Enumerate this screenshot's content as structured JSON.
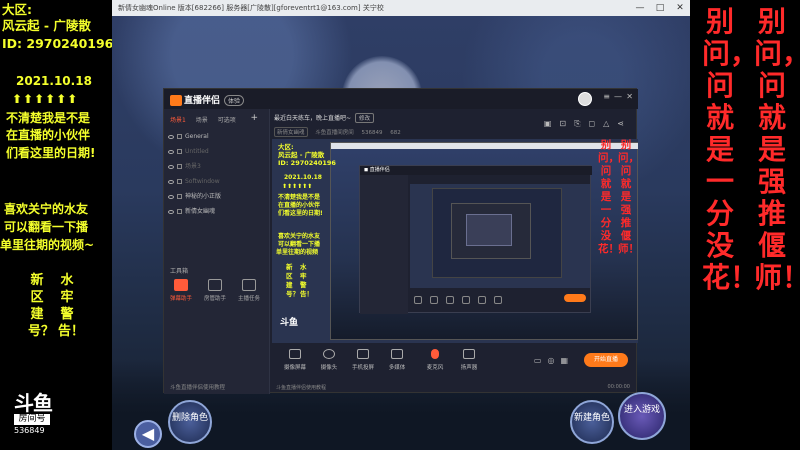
{
  "left_overlay": {
    "line1": "大区:",
    "line2": "风云起 - 广陵散",
    "line3": "ID: 2970240196",
    "date": "2021.10.18",
    "arrows": "⬆⬆⬆⬆⬆⬆",
    "note1": "不清楚我是不是",
    "note2": "在直播的小伙伴",
    "note3": "们看这里的日期!",
    "note4": "喜欢关宁的水友",
    "note5": "可以翻看一下播",
    "note6": "单里往期的视频~",
    "vert_left": "新区建号？",
    "vert_right": "水牢警告！"
  },
  "douyu": {
    "mark": "斗鱼",
    "sub": "房间号",
    "room": "536849"
  },
  "right_overlay": {
    "col1": "别问，问就是一分没花！",
    "col2": "别问，问就是强推偃师！"
  },
  "window": {
    "title": "新倩女幽魂Online 版本[682266] 服务器[广陵散][gforeventrt1@163.com] 关宁校",
    "controls": [
      "—",
      "□",
      "✕"
    ]
  },
  "app": {
    "logo": "直播伴侣",
    "badge": "体验",
    "tabs": [
      "场景1",
      "场景",
      "可选项"
    ],
    "scenes": [
      {
        "label": "General",
        "dim": false
      },
      {
        "label": "Untitled",
        "dim": true
      },
      {
        "label": "场景3",
        "dim": true
      },
      {
        "label": "Softwindow",
        "dim": true
      },
      {
        "label": "神秘的小正版",
        "dim": false
      },
      {
        "label": "新倩女幽魂",
        "dim": false
      }
    ],
    "tools_label": "工具箱",
    "tools": [
      {
        "label": "弹幕助手",
        "hot": true
      },
      {
        "label": "房管助手",
        "hot": false
      },
      {
        "label": "主播任务",
        "hot": false
      }
    ],
    "side_bottom": "斗鱼直播伴侣使用教程",
    "stream_title": "最近白天练车，晚上直播吧~",
    "edit_label": "修改",
    "sub_tags": [
      "新倩女幽魂",
      "斗鱼直播间房间",
      "536849",
      "682"
    ],
    "toolbar": [
      {
        "label": "摄像屏幕",
        "shape": "sq"
      },
      {
        "label": "摄像头",
        "shape": "round"
      },
      {
        "label": "手机投屏",
        "shape": "sq"
      },
      {
        "label": "多媒体",
        "shape": "sq"
      },
      {
        "label": "麦克风",
        "shape": "mic"
      },
      {
        "label": "扬声器",
        "shape": "sq"
      }
    ],
    "go_live": "开始直播",
    "status_left": "斗鱼直播伴侣使用教程",
    "status_right": "00:00:00"
  },
  "inner_overlay": {
    "l1": "大区:",
    "l2": "风云起 - 广陵散",
    "l3": "ID: 2970240196",
    "date": "2021.10.18",
    "arrows": "⬆⬆⬆⬆⬆⬆",
    "n1": "不清楚我是不是",
    "n2": "在直播的小伙伴",
    "n3": "们看这里的日期!",
    "n4": "喜欢关宁的水友",
    "n5": "可以翻看一下播",
    "n6": "单里往期的视频",
    "v1": "新区建号？",
    "v2": "水牢警告！",
    "r1": "别问，问就是一分没花！",
    "r2": "别问，问就是强推偃师！"
  },
  "game": {
    "delete": "删除角色",
    "create": "新建角色",
    "enter": "进入游戏",
    "back": "◀"
  }
}
